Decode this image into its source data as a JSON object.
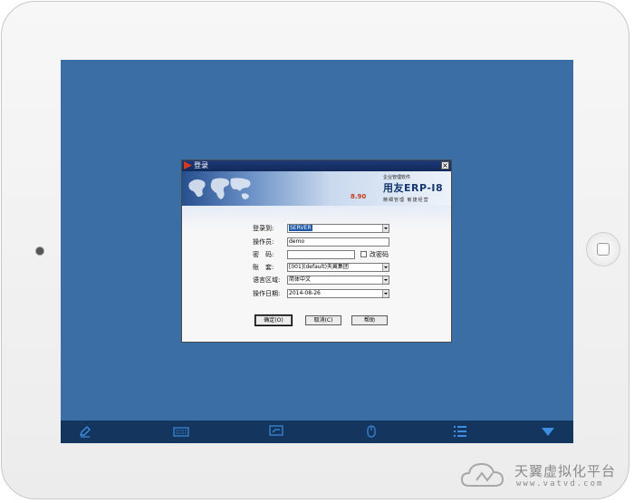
{
  "dialog": {
    "title": "登录",
    "close_glyph": "×",
    "banner": {
      "slogan": "企业管理软件",
      "brand": "用友ERP-I8",
      "version": "8.90",
      "motto": "精细管理  敏捷经营"
    },
    "fields": {
      "server": {
        "label": "登录到:",
        "value": "SERVER"
      },
      "operator": {
        "label": "操作员:",
        "value": "demo"
      },
      "password": {
        "label": "密　码:",
        "value": ""
      },
      "change_password": {
        "label": "改密码",
        "checked": false
      },
      "account": {
        "label": "账　套:",
        "value": "[001](default)天翼集团"
      },
      "language": {
        "label": "语言区域:",
        "value": "简体中文"
      },
      "date": {
        "label": "操作日期:",
        "value": "2014-08-26"
      }
    },
    "buttons": {
      "ok": "确定(O)",
      "cancel": "取消(C)",
      "help": "帮助"
    }
  },
  "taskbar": {
    "icons": [
      "edit-icon",
      "keyboard-icon",
      "screen-icon",
      "mouse-icon",
      "list-icon",
      "collapse-icon"
    ]
  },
  "watermark": {
    "name": "天翼虚拟化平台",
    "url": "www.vatvd.com"
  },
  "colors": {
    "desktop": "#3a6ea4",
    "taskbar": "#13355e",
    "title_bar": "#1d3a78",
    "selection": "#1c57a8",
    "taskbar_icon": "#3d8de0"
  }
}
